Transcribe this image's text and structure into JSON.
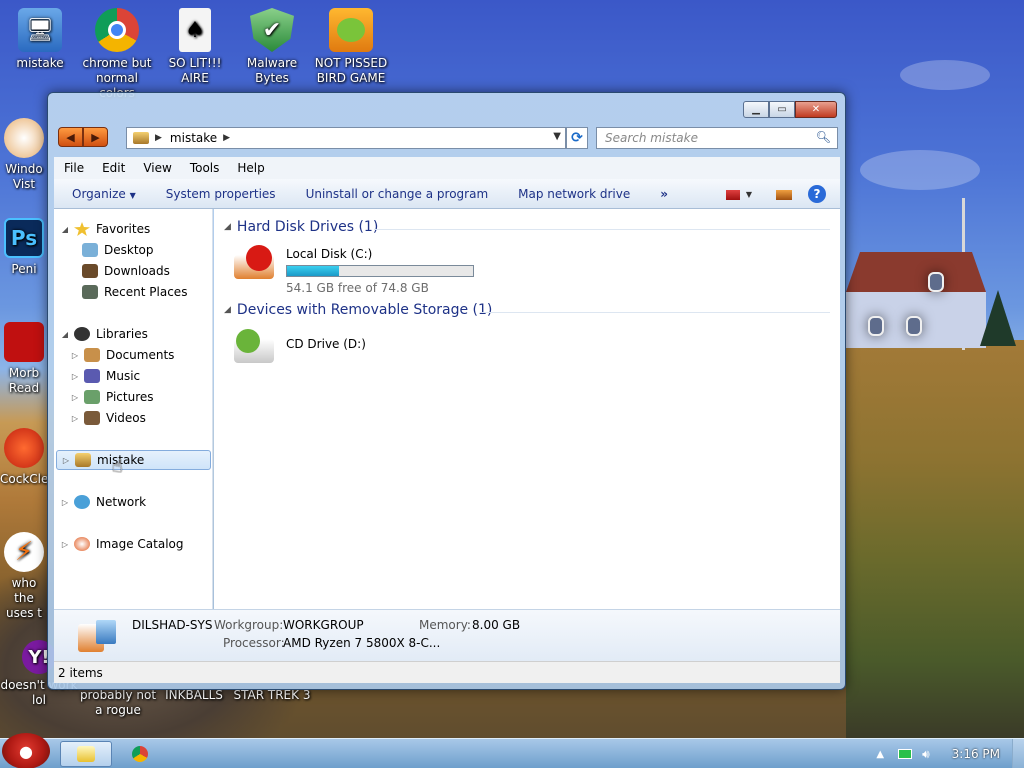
{
  "desktop": {
    "icons": [
      {
        "label": "mistake"
      },
      {
        "label": "chrome but normal colors"
      },
      {
        "label": "SO LIT!!! AIRE"
      },
      {
        "label": "Malware Bytes"
      },
      {
        "label": "NOT PISSED BIRD GAME"
      }
    ],
    "left_icons": [
      {
        "label": "Windo Vist"
      },
      {
        "label": "Peni"
      },
      {
        "label": "Morb Read"
      },
      {
        "label": "CockCle"
      },
      {
        "label": "who the uses t"
      },
      {
        "label": "doesn't work lol"
      }
    ],
    "bottom_icons": [
      {
        "label": "probably not a rogue"
      },
      {
        "label": "INKBALLS"
      },
      {
        "label": "STAR TREK 3"
      }
    ]
  },
  "window": {
    "address": {
      "crumb": "mistake",
      "search_placeholder": "Search mistake"
    },
    "menu": [
      "File",
      "Edit",
      "View",
      "Tools",
      "Help"
    ],
    "toolbar": {
      "organize": "Organize",
      "system_properties": "System properties",
      "uninstall": "Uninstall or change a program",
      "map_drive": "Map network drive",
      "more": "»"
    },
    "nav": {
      "favorites": "Favorites",
      "desktop": "Desktop",
      "downloads": "Downloads",
      "recent": "Recent Places",
      "libraries": "Libraries",
      "documents": "Documents",
      "music": "Music",
      "pictures": "Pictures",
      "videos": "Videos",
      "computer": "mistake",
      "network": "Network",
      "image_catalog": "Image Catalog"
    },
    "groups": {
      "hdd": "Hard Disk Drives (1)",
      "removable": "Devices with Removable Storage (1)"
    },
    "drives": {
      "c_name": "Local Disk (C:)",
      "c_free": "54.1 GB free of 74.8 GB",
      "c_used_fraction": 0.277,
      "d_name": "CD Drive (D:)"
    },
    "details": {
      "computer_name": "DILSHAD-SYS",
      "workgroup_label": "Workgroup:",
      "workgroup": "WORKGROUP",
      "memory_label": "Memory:",
      "memory": "8.00 GB",
      "processor_label": "Processor:",
      "processor": "AMD Ryzen 7 5800X 8-C..."
    },
    "status": "2 items"
  },
  "taskbar": {
    "clock": "3:16 PM"
  }
}
